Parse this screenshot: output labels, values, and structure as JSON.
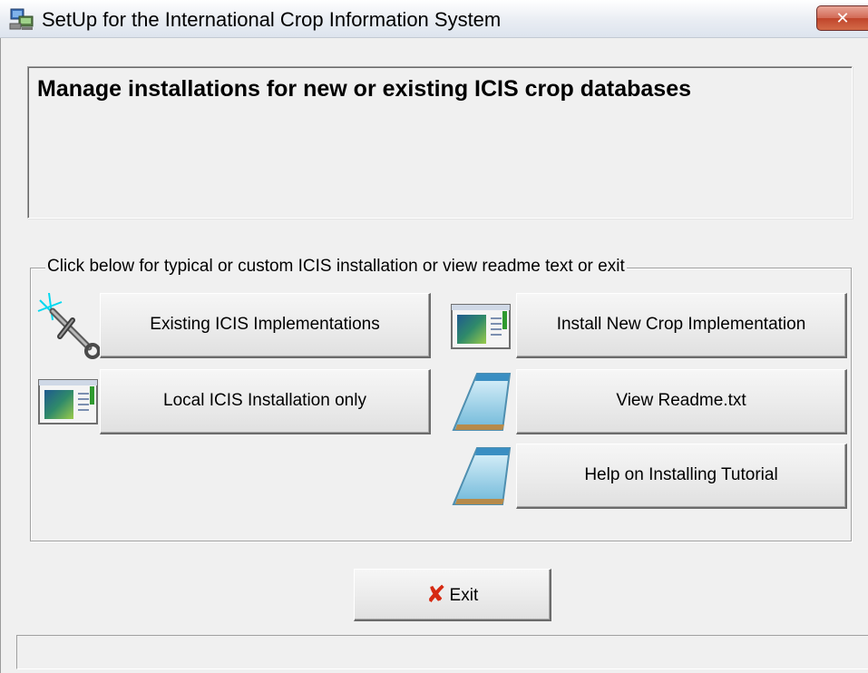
{
  "window": {
    "title": "SetUp for the International Crop Information System",
    "close_label": "✕"
  },
  "header": {
    "text": "Manage installations for new or existing ICIS crop databases"
  },
  "group": {
    "legend": "Click below for typical or custom ICIS installation or view readme text or exit"
  },
  "buttons": {
    "existing": "Existing ICIS Implementations",
    "install_new": "Install New Crop Implementation",
    "local": "Local ICIS Installation only",
    "readme": "View Readme.txt",
    "help": "Help on Installing Tutorial",
    "exit": "Exit"
  },
  "icons": {
    "title": "setup-computer-icon",
    "existing": "tools-wrench-icon",
    "install_new": "window-app-icon",
    "local": "window-app-icon",
    "readme": "notepad-icon",
    "help": "notepad-icon",
    "exit": "red-x-icon"
  },
  "statusbar": {
    "text": ""
  }
}
